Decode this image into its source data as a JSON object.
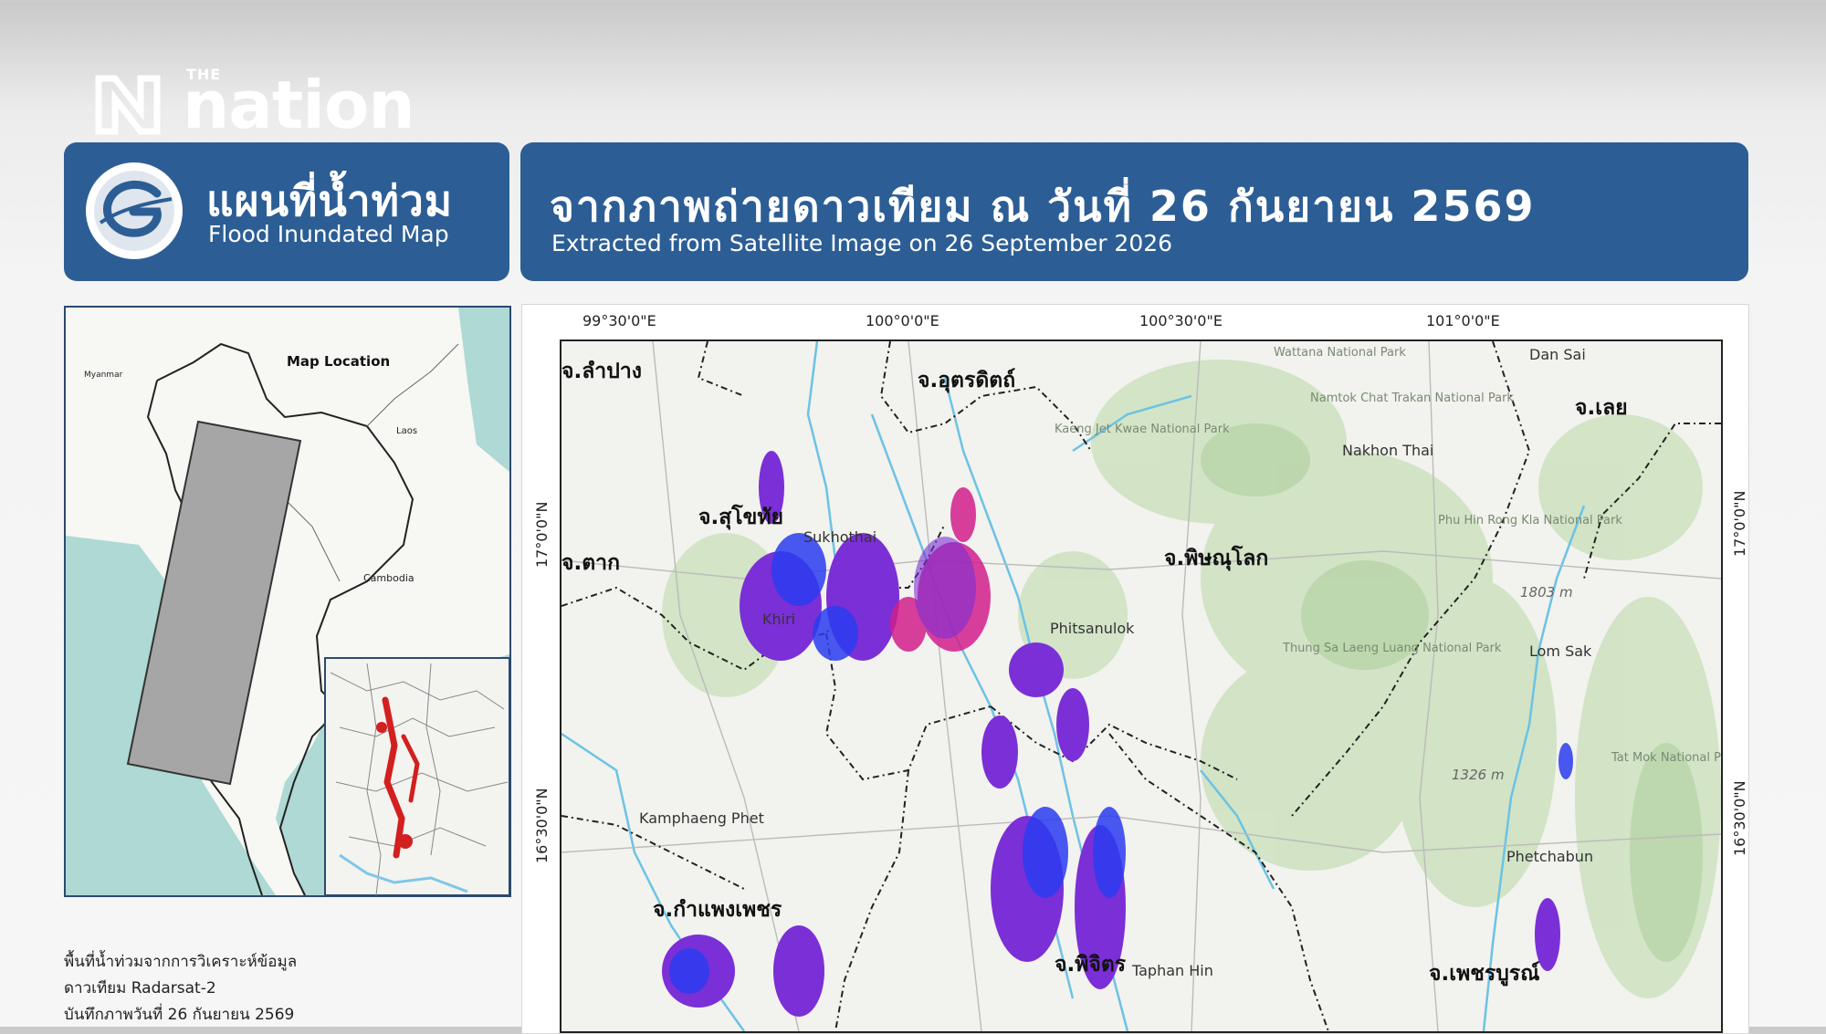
{
  "brand": {
    "the": "THE",
    "name": "nation"
  },
  "title_left": {
    "thai": "แผนที่น้ำท่วม",
    "english": "Flood Inundated Map"
  },
  "title_right": {
    "thai": "จากภาพถ่ายดาวเทียม ณ วันที่ 26 กันยายน 2569",
    "english": "Extracted from Satellite Image on 26 September 2026"
  },
  "location_map": {
    "title": "Map Location",
    "countries": [
      "Myanmar",
      "Laos",
      "Cambodia"
    ]
  },
  "coordinates": {
    "top": [
      "99°30'0\"E",
      "100°0'0\"E",
      "100°30'0\"E",
      "101°0'0\"E"
    ],
    "left": [
      "17°0'0\"N",
      "16°30'0\"N"
    ],
    "right": [
      "17°0'0\"N",
      "16°30'0\"N"
    ]
  },
  "provinces": [
    "จ.ลำปาง",
    "จ.อุตรดิตถ์",
    "จ.เลย",
    "จ.สุโขทัย",
    "จ.ตาก",
    "จ.พิษณุโลก",
    "จ.กำแพงเพชร",
    "จ.พิจิตร",
    "จ.เพชรบูรณ์"
  ],
  "places": [
    "Dan Sai",
    "Nakhon Thai",
    "Phitsanulok",
    "Lom Sak",
    "Kamphaeng Phet",
    "Phetchabun",
    "Wattana National Park",
    "Namtok Chat Trakan National Park",
    "Kaeng Jet Kwae National Park",
    "Thung Sa Laeng Luang National Park",
    "Phu Hin Rong Kla National Park",
    "Tat Mok National Park",
    "Taphan Hin",
    "Khiri",
    "Sukhothai"
  ],
  "elevations": [
    "1803 m",
    "1326 m"
  ],
  "info_lines": [
    "พื้นที่น้ำท่วมจากการวิเคราะห์ข้อมูล",
    "ดาวเทียม Radarsat-2",
    "บันทึกภาพวันที่ 26 กันยายน 2569"
  ],
  "colors": {
    "header_blue": "#2c5e95",
    "flood_purple": "#7b2fd6",
    "flood_blue": "#2a3cf0",
    "flood_magenta": "#d21f8c"
  }
}
